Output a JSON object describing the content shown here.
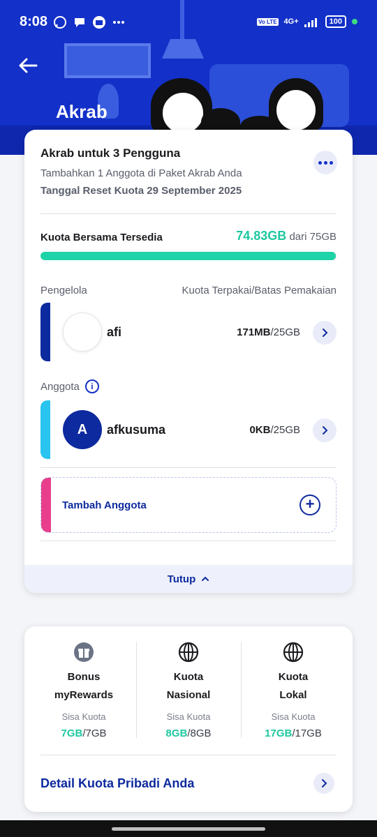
{
  "status_bar": {
    "time": "8:08",
    "network": "4G+",
    "battery": "100",
    "volte": "Vo LTE"
  },
  "header": {
    "title": "Akrab"
  },
  "plan_card": {
    "title": "Akrab untuk 3 Pengguna",
    "subtitle": "Tambahkan 1 Anggota di Paket Akrab Anda",
    "reset": "Tanggal Reset Kuota 29 September 2025",
    "shared_label": "Kuota Bersama Tersedia",
    "shared_value": "74.83GB",
    "shared_total": "dari 75GB",
    "shared_fraction": 0.9977,
    "col_left": "Pengelola",
    "col_right": "Kuota Terpakai/Batas Pemakaian",
    "manager": {
      "name": "afi",
      "used": "171MB",
      "limit": "/25GB",
      "accent": "#0d2a9e"
    },
    "members_label": "Anggota",
    "member": {
      "initial": "A",
      "name": "afkusuma",
      "used": "0KB",
      "limit": "/25GB",
      "accent": "#29c4ef"
    },
    "add_member": "Tambah Anggota",
    "collapse": "Tutup"
  },
  "quota_card": {
    "columns": [
      {
        "icon": "gift-icon",
        "title1": "Bonus",
        "title2": "myRewards",
        "sub": "Sisa Kuota",
        "remaining": "7GB",
        "total": "/7GB"
      },
      {
        "icon": "globe-icon",
        "title1": "Kuota",
        "title2": "Nasional",
        "sub": "Sisa Kuota",
        "remaining": "8GB",
        "total": "/8GB"
      },
      {
        "icon": "globe-icon",
        "title1": "Kuota",
        "title2": "Lokal",
        "sub": "Sisa Kuota",
        "remaining": "17GB",
        "total": "/17GB"
      }
    ],
    "detail_link": "Detail Kuota Pribadi Anda"
  },
  "colors": {
    "brand_blue": "#1330c8",
    "accent_green": "#1dc8a0",
    "pink": "#e83e8c"
  }
}
